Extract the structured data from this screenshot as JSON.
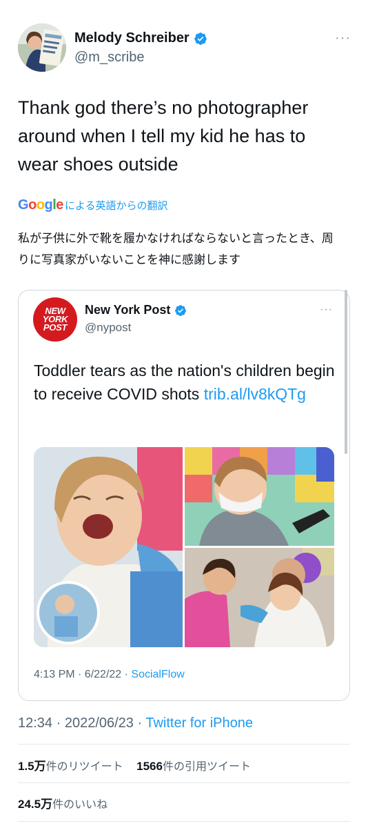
{
  "tweet": {
    "author_name": "Melody Schreiber",
    "author_handle": "@m_scribe",
    "more_label": "···",
    "text": "Thank god there’s no photographer around when I tell my kid he has to wear shoes outside",
    "translate_suffix": "による英語からの翻訳",
    "google_letters": [
      "G",
      "o",
      "o",
      "g",
      "l",
      "e"
    ],
    "translation": "私が子供に外で靴を履かなければならないと言ったとき、周りに写真家がいないことを神に感謝します",
    "timestamp": "12:34 · 2022/06/23 · ",
    "source": "Twitter for iPhone"
  },
  "quoted": {
    "logo_lines": [
      "NEW",
      "YORK",
      "POST"
    ],
    "author_name": "New York Post",
    "author_handle": "@nypost",
    "more_label": "···",
    "text": "Toddler tears as the nation's children begin to receive COVID shots ",
    "link_text": "trib.al/lv8kQTg",
    "timestamp": "4:13 PM · 6/22/22 · ",
    "source": "SocialFlow"
  },
  "stats": {
    "retweets_count": "1.5万",
    "retweets_label": "件のリツイート",
    "quotes_count": "1566",
    "quotes_label": "件の引用ツイート",
    "likes_count": "24.5万",
    "likes_label": "件のいいね"
  },
  "colors": {
    "accent": "#1d9bf0",
    "nypost_red": "#d41a1f"
  },
  "icons": {
    "verified": "verified-badge-icon",
    "more": "more-horizontal-icon"
  }
}
